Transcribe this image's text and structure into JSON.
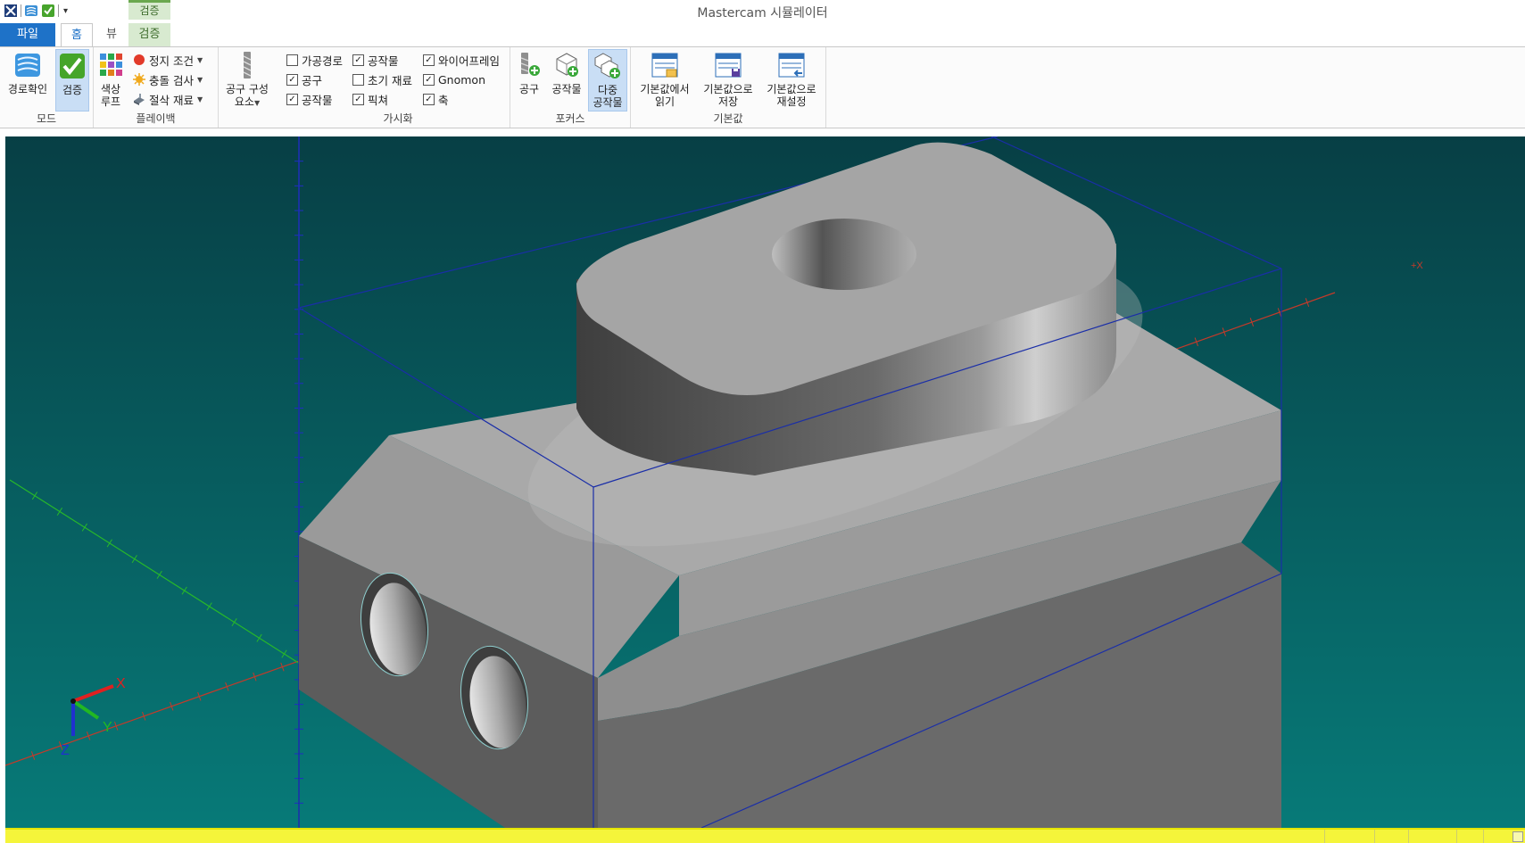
{
  "app": {
    "title": "Mastercam 시뮬레이터"
  },
  "quick_access": {
    "icons": [
      "mastercam-logo-icon",
      "path-check-icon",
      "verify-check-icon"
    ],
    "more_label": "▾"
  },
  "context_header": "검증",
  "tabs": [
    {
      "id": "file",
      "label": "파일"
    },
    {
      "id": "home",
      "label": "홈"
    },
    {
      "id": "view",
      "label": "뷰"
    },
    {
      "id": "verify",
      "label": "검증"
    }
  ],
  "ribbon": {
    "mode": {
      "label": "모드",
      "backplot": "경로확인",
      "verify": "검증"
    },
    "playback": {
      "label": "플레이백",
      "color_loop_line1": "색상",
      "color_loop_line2": "루프",
      "stop_conditions": "정지 조건",
      "collision_check": "충돌 검사",
      "cut_stock": "절삭 재료"
    },
    "tool_components": {
      "line1": "공구 구성",
      "line2": "요소"
    },
    "visibility": {
      "label": "가시화",
      "items": [
        {
          "label": "가공경로",
          "checked": false
        },
        {
          "label": "공구",
          "checked": true
        },
        {
          "label": "공작물",
          "checked": true
        },
        {
          "label": "공작물",
          "checked": true
        },
        {
          "label": "초기 재료",
          "checked": false
        },
        {
          "label": "픽쳐",
          "checked": true
        },
        {
          "label": "와이어프레임",
          "checked": true
        },
        {
          "label": "Gnomon",
          "checked": true
        },
        {
          "label": "축",
          "checked": true
        }
      ]
    },
    "focus": {
      "label": "포커스",
      "tool": "공구",
      "workpiece": "공작물",
      "multi_line1": "다중",
      "multi_line2": "공작물"
    },
    "defaults": {
      "label": "기본값",
      "load_line1": "기본값에서",
      "load_line2": "읽기",
      "save_line1": "기본값으로",
      "save_line2": "저장",
      "reset_line1": "기본값으로",
      "reset_line2": "재설정"
    }
  },
  "viewport": {
    "background_top": "#073f45",
    "background_bottom": "#077a78",
    "gnomon": {
      "x": "X",
      "y": "Y",
      "z": "Z"
    },
    "axis_marker": "+X",
    "colors": {
      "x_axis": "#c43a2a",
      "y_axis": "#27b82a",
      "z_axis": "#1f2ec2",
      "bbox": "#1a2ea8",
      "part_top": "#a8a8a8",
      "part_side": "#5c5c5c"
    }
  },
  "statusbar": {
    "color": "#f5f53a"
  }
}
